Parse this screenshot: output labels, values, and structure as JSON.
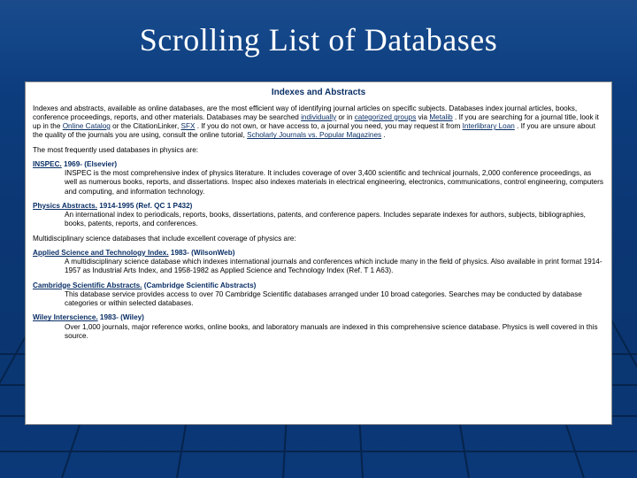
{
  "title": "Scrolling List of Databases",
  "panel_heading": "Indexes and Abstracts",
  "intro_parts": {
    "p1a": "Indexes and abstracts, available as online databases, are the most efficient way of identifying journal articles on specific subjects. Databases index journal articles, books, conference proceedings, reports, and other materials. Databases may be searched ",
    "link1": "individually",
    "p1b": " or in ",
    "link2": "categorized groups",
    "p1c": " via ",
    "link3": "Metalib",
    "p1d": ". If you are searching for a journal title, look it up in the ",
    "link4": "Online Catalog",
    "p1e": " or the CitationLinker, ",
    "link5": "SFX",
    "p1f": ". If you do not own, or have access to, a journal you need, you may request it from ",
    "link6": "Interlibrary Loan",
    "p1g": ". If you are unsure about the quality of the journals you are using, consult the online tutorial, ",
    "link7": "Scholarly Journals vs. Popular Magazines",
    "p1h": "."
  },
  "lead1": "The most frequently used databases in physics are:",
  "db": [
    {
      "name": "INSPEC.",
      "meta": " 1969- (Elsevier)",
      "desc": "INSPEC is the most comprehensive index of physics literature. It includes coverage of over 3,400 scientific and technical journals, 2,000 conference proceedings, as well as numerous books, reports, and dissertations. Inspec also indexes materials in electrical engineering, electronics, communications, control engineering, computers and computing, and information technology."
    },
    {
      "name": "Physics Abstracts.",
      "meta": " 1914-1995 (Ref. QC 1 P432)",
      "desc": "An international index to periodicals, reports, books, dissertations, patents, and conference papers. Includes separate indexes for authors, subjects, bibliographies, books, patents, reports, and conferences."
    }
  ],
  "lead2": "Multidisciplinary science databases that include excellent coverage of physics are:",
  "db2": [
    {
      "name": "Applied Science and Technology Index.",
      "meta": " 1983- (WilsonWeb)",
      "desc": "A multidisciplinary science database which indexes international journals and conferences which include many in the field of physics. Also available in print format 1914-1957 as Industrial Arts Index, and 1958-1982 as Applied Science and Technology Index (Ref. T 1 A63)."
    },
    {
      "name": "Cambridge Scientific Abstracts.",
      "meta": "  (Cambridge Scientific Abstracts)",
      "desc": "This database service provides access to over 70 Cambridge Scientific databases arranged under 10 broad categories. Searches may be conducted by database categories or within selected databases."
    },
    {
      "name": "Wiley Interscience.",
      "meta": " 1983- (Wiley)",
      "desc": "Over 1,000 journals, major reference works, online books, and laboratory manuals are indexed in this comprehensive science database. Physics is well covered in this source."
    }
  ]
}
